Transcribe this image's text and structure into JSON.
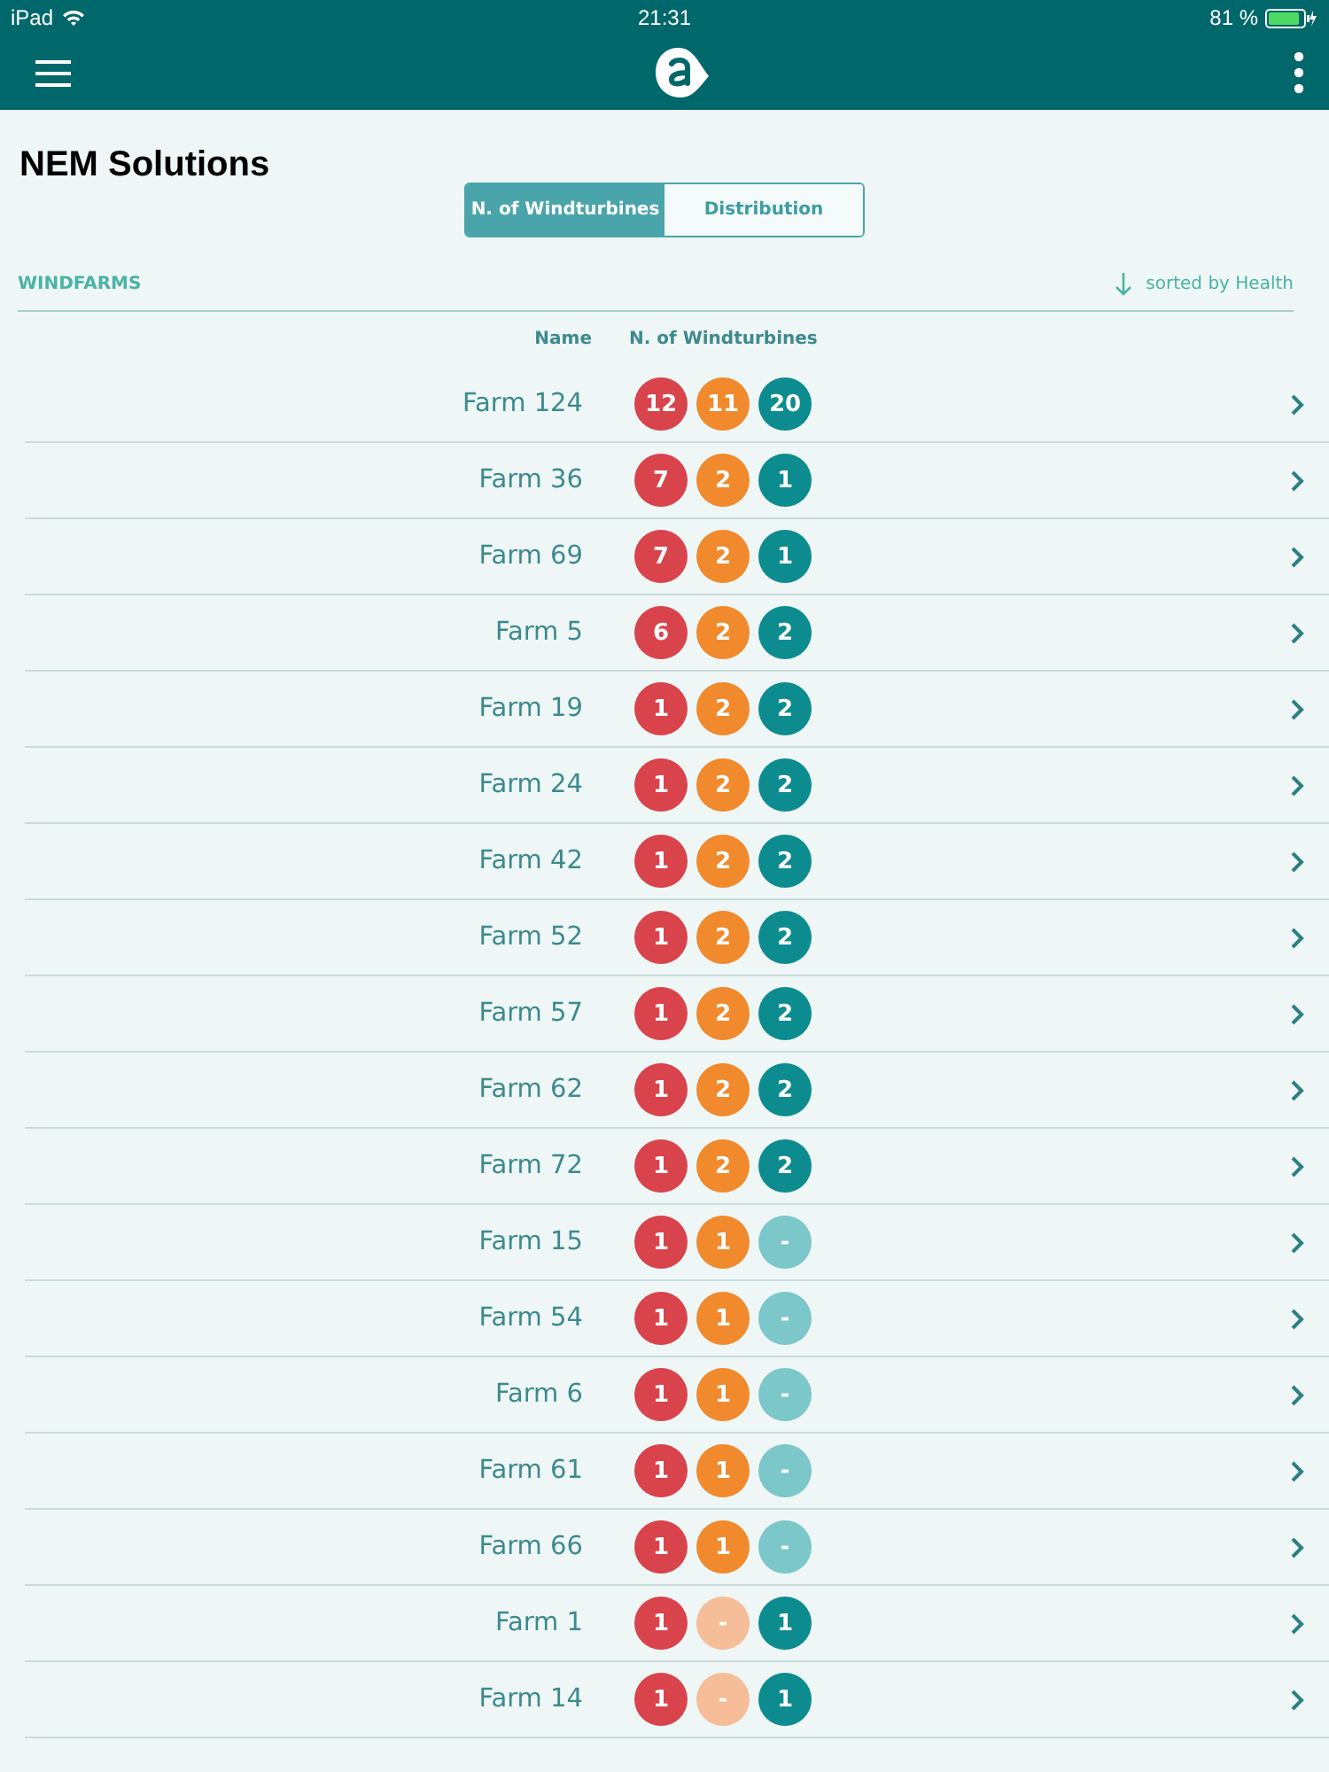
{
  "status_bar": {
    "device": "iPad",
    "time": "21:31",
    "battery": "81 %"
  },
  "title": "NEM Solutions",
  "tabs": [
    {
      "label": "N. of Windturbines",
      "selected": true
    },
    {
      "label": "Distribution",
      "selected": false
    }
  ],
  "section": {
    "title": "WINDFARMS",
    "sort": "sorted by Health"
  },
  "columns": [
    "Name",
    "N. of Windturbines"
  ],
  "rows": [
    {
      "name": "Farm 124",
      "counts": [
        {
          "kind": "critical",
          "value": "12",
          "empty": false
        },
        {
          "kind": "warning",
          "value": "11",
          "empty": false
        },
        {
          "kind": "ok",
          "value": "20",
          "empty": false
        }
      ]
    },
    {
      "name": "Farm 36",
      "counts": [
        {
          "kind": "critical",
          "value": "7",
          "empty": false
        },
        {
          "kind": "warning",
          "value": "2",
          "empty": false
        },
        {
          "kind": "ok",
          "value": "1",
          "empty": false
        }
      ]
    },
    {
      "name": "Farm 69",
      "counts": [
        {
          "kind": "critical",
          "value": "7",
          "empty": false
        },
        {
          "kind": "warning",
          "value": "2",
          "empty": false
        },
        {
          "kind": "ok",
          "value": "1",
          "empty": false
        }
      ]
    },
    {
      "name": "Farm 5",
      "counts": [
        {
          "kind": "critical",
          "value": "6",
          "empty": false
        },
        {
          "kind": "warning",
          "value": "2",
          "empty": false
        },
        {
          "kind": "ok",
          "value": "2",
          "empty": false
        }
      ]
    },
    {
      "name": "Farm 19",
      "counts": [
        {
          "kind": "critical",
          "value": "1",
          "empty": false
        },
        {
          "kind": "warning",
          "value": "2",
          "empty": false
        },
        {
          "kind": "ok",
          "value": "2",
          "empty": false
        }
      ]
    },
    {
      "name": "Farm 24",
      "counts": [
        {
          "kind": "critical",
          "value": "1",
          "empty": false
        },
        {
          "kind": "warning",
          "value": "2",
          "empty": false
        },
        {
          "kind": "ok",
          "value": "2",
          "empty": false
        }
      ]
    },
    {
      "name": "Farm 42",
      "counts": [
        {
          "kind": "critical",
          "value": "1",
          "empty": false
        },
        {
          "kind": "warning",
          "value": "2",
          "empty": false
        },
        {
          "kind": "ok",
          "value": "2",
          "empty": false
        }
      ]
    },
    {
      "name": "Farm 52",
      "counts": [
        {
          "kind": "critical",
          "value": "1",
          "empty": false
        },
        {
          "kind": "warning",
          "value": "2",
          "empty": false
        },
        {
          "kind": "ok",
          "value": "2",
          "empty": false
        }
      ]
    },
    {
      "name": "Farm 57",
      "counts": [
        {
          "kind": "critical",
          "value": "1",
          "empty": false
        },
        {
          "kind": "warning",
          "value": "2",
          "empty": false
        },
        {
          "kind": "ok",
          "value": "2",
          "empty": false
        }
      ]
    },
    {
      "name": "Farm 62",
      "counts": [
        {
          "kind": "critical",
          "value": "1",
          "empty": false
        },
        {
          "kind": "warning",
          "value": "2",
          "empty": false
        },
        {
          "kind": "ok",
          "value": "2",
          "empty": false
        }
      ]
    },
    {
      "name": "Farm 72",
      "counts": [
        {
          "kind": "critical",
          "value": "1",
          "empty": false
        },
        {
          "kind": "warning",
          "value": "2",
          "empty": false
        },
        {
          "kind": "ok",
          "value": "2",
          "empty": false
        }
      ]
    },
    {
      "name": "Farm 15",
      "counts": [
        {
          "kind": "critical",
          "value": "1",
          "empty": false
        },
        {
          "kind": "warning",
          "value": "1",
          "empty": false
        },
        {
          "kind": "ok",
          "value": "-",
          "empty": true
        }
      ]
    },
    {
      "name": "Farm 54",
      "counts": [
        {
          "kind": "critical",
          "value": "1",
          "empty": false
        },
        {
          "kind": "warning",
          "value": "1",
          "empty": false
        },
        {
          "kind": "ok",
          "value": "-",
          "empty": true
        }
      ]
    },
    {
      "name": "Farm 6",
      "counts": [
        {
          "kind": "critical",
          "value": "1",
          "empty": false
        },
        {
          "kind": "warning",
          "value": "1",
          "empty": false
        },
        {
          "kind": "ok",
          "value": "-",
          "empty": true
        }
      ]
    },
    {
      "name": "Farm 61",
      "counts": [
        {
          "kind": "critical",
          "value": "1",
          "empty": false
        },
        {
          "kind": "warning",
          "value": "1",
          "empty": false
        },
        {
          "kind": "ok",
          "value": "-",
          "empty": true
        }
      ]
    },
    {
      "name": "Farm 66",
      "counts": [
        {
          "kind": "critical",
          "value": "1",
          "empty": false
        },
        {
          "kind": "warning",
          "value": "1",
          "empty": false
        },
        {
          "kind": "ok",
          "value": "-",
          "empty": true
        }
      ]
    },
    {
      "name": "Farm 1",
      "counts": [
        {
          "kind": "critical",
          "value": "1",
          "empty": false
        },
        {
          "kind": "warning",
          "value": "-",
          "empty": true
        },
        {
          "kind": "ok",
          "value": "1",
          "empty": false
        }
      ]
    },
    {
      "name": "Farm 14",
      "counts": [
        {
          "kind": "critical",
          "value": "1",
          "empty": false
        },
        {
          "kind": "warning",
          "value": "-",
          "empty": true
        },
        {
          "kind": "ok",
          "value": "1",
          "empty": false
        }
      ]
    }
  ]
}
